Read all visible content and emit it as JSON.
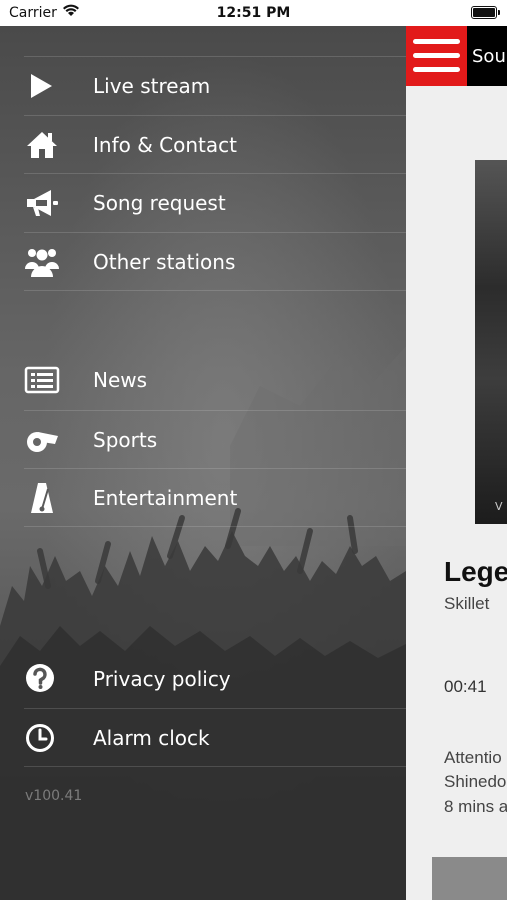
{
  "status_bar": {
    "carrier": "Carrier",
    "time": "12:51 PM"
  },
  "drawer": {
    "version": "v100.41",
    "groups": [
      {
        "items": [
          {
            "label": "Live stream",
            "icon": "play-icon"
          },
          {
            "label": "Info & Contact",
            "icon": "home-icon"
          },
          {
            "label": "Song request",
            "icon": "megaphone-icon"
          },
          {
            "label": "Other stations",
            "icon": "group-icon"
          }
        ]
      },
      {
        "items": [
          {
            "label": "News",
            "icon": "newspaper-icon"
          },
          {
            "label": "Sports",
            "icon": "whistle-icon"
          },
          {
            "label": "Entertainment",
            "icon": "metronome-icon"
          }
        ]
      },
      {
        "items": [
          {
            "label": "Privacy policy",
            "icon": "help-circle-icon"
          },
          {
            "label": "Alarm clock",
            "icon": "clock-icon"
          }
        ]
      }
    ]
  },
  "main": {
    "station_title": "Sou",
    "cover_letter": "V",
    "now_playing": {
      "title": "Lege",
      "artist": "Skillet",
      "elapsed": "00:41"
    },
    "news": [
      "Attentio",
      "Shinedo",
      "8 mins a"
    ]
  },
  "colors": {
    "accent": "#e21a1a",
    "drawer_text": "#ffffff",
    "version_text": "#7b7b7b"
  }
}
